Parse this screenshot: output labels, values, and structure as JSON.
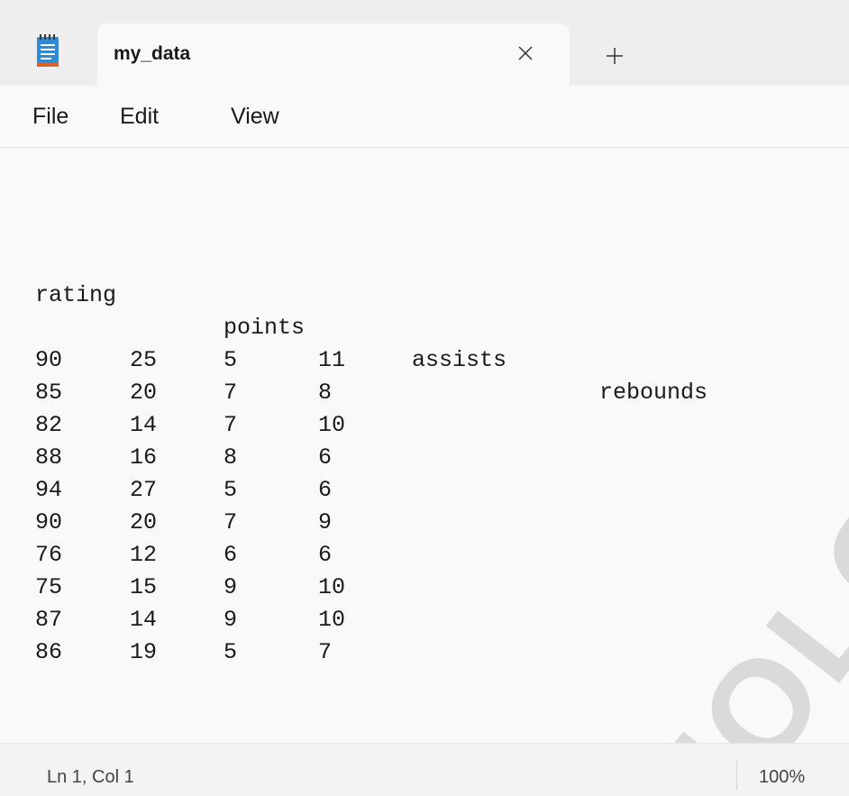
{
  "tab": {
    "title": "my_data",
    "close_icon": "close-icon",
    "new_tab_icon": "plus-icon"
  },
  "app_icon": "notepad-icon",
  "menu": {
    "items": [
      "File",
      "Edit",
      "View"
    ]
  },
  "document": {
    "header": [
      "rating",
      "points",
      "assists",
      "rebounds"
    ],
    "rows": [
      [
        "90",
        "25",
        "5",
        "11"
      ],
      [
        "85",
        "20",
        "7",
        "8"
      ],
      [
        "82",
        "14",
        "7",
        "10"
      ],
      [
        "88",
        "16",
        "8",
        "6"
      ],
      [
        "94",
        "27",
        "5",
        "6"
      ],
      [
        "90",
        "20",
        "7",
        "9"
      ],
      [
        "76",
        "12",
        "6",
        "6"
      ],
      [
        "75",
        "15",
        "9",
        "10"
      ],
      [
        "87",
        "14",
        "9",
        "10"
      ],
      [
        "86",
        "19",
        "5",
        "7"
      ]
    ]
  },
  "status": {
    "position": "Ln 1, Col 1",
    "zoom": "100%"
  },
  "watermark": {
    "text": "IOLOGY",
    "color": "#000000"
  },
  "colors": {
    "accent": "#1a1a1a",
    "app_icon_blue": "#2f8bd6",
    "app_icon_orange": "#d9622b"
  }
}
